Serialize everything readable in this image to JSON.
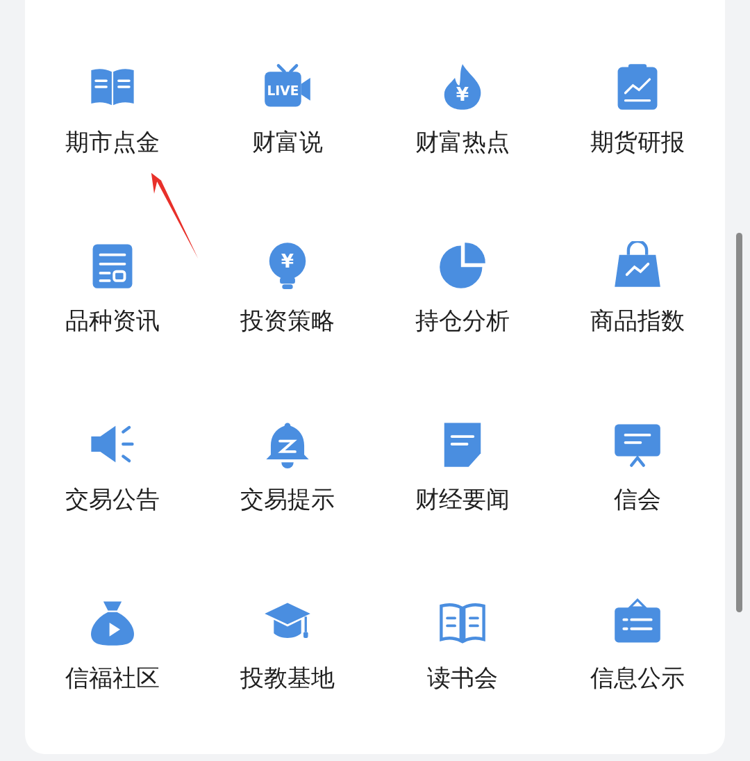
{
  "grid": [
    {
      "label": "期市点金"
    },
    {
      "label": "财富说",
      "icon_text": "LIVE"
    },
    {
      "label": "财富热点",
      "icon_text": "¥"
    },
    {
      "label": "期货研报"
    },
    {
      "label": "品种资讯"
    },
    {
      "label": "投资策略",
      "icon_text": "¥"
    },
    {
      "label": "持仓分析"
    },
    {
      "label": "商品指数"
    },
    {
      "label": "交易公告"
    },
    {
      "label": "交易提示"
    },
    {
      "label": "财经要闻"
    },
    {
      "label": "信会"
    },
    {
      "label": "信福社区"
    },
    {
      "label": "投教基地"
    },
    {
      "label": "读书会"
    },
    {
      "label": "信息公示"
    }
  ]
}
